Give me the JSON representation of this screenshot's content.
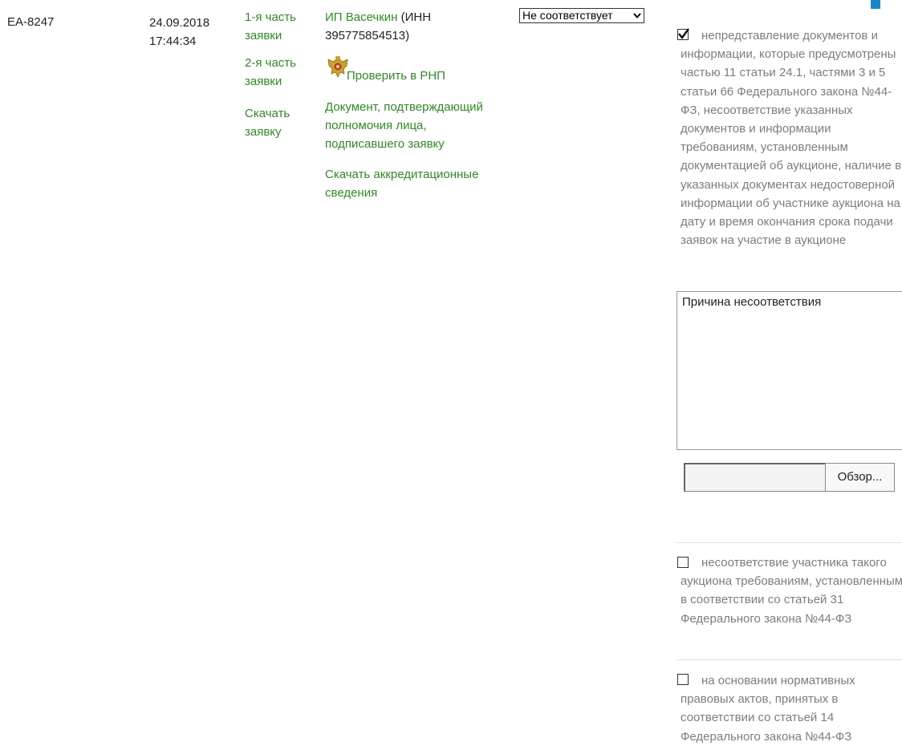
{
  "row": {
    "id": "ЕА-8247",
    "date": "24.09.2018",
    "time": "17:44:34",
    "parts": {
      "part1": [
        "1-я часть",
        "заявки"
      ],
      "part2": [
        "2-я часть",
        "заявки"
      ],
      "download": [
        "Скачать",
        "заявку"
      ]
    },
    "participant": {
      "name": "ИП Васечкин",
      "inn_line1": " (ИНН",
      "inn_line2": "395775854513)"
    },
    "rnp_check": "Проверить в РНП",
    "authority_doc": [
      "Документ, подтверждающий",
      "полномочия лица,",
      "подписавшего заявку"
    ],
    "accreditation": [
      "Скачать аккредитационные",
      "сведения"
    ],
    "decision": {
      "selected": "Не соответствует"
    }
  },
  "reasons": [
    {
      "checked": true,
      "text": "непредставление документов и информации, которые предусмотрены частью 11 статьи 24.1, частями 3 и 5 статьи 66 Федерального закона №44-ФЗ, несоответствие указанных документов и информации требованиям, установленным документацией об аукционе, наличие в указанных документах недостоверной информации об участнике аукциона на дату и время окончания срока подачи заявок на участие в аукционе"
    },
    {
      "checked": false,
      "text": "несоответствие участника такого аукциона требованиям, установленным в соответствии со статьей 31 Федерального закона №44-ФЗ"
    },
    {
      "checked": false,
      "text": "на основании нормативных правовых актов, принятых в соответствии со статьей 14 Федерального закона №44-ФЗ"
    }
  ],
  "mismatch_reason": {
    "value": "Причина несоответствия"
  },
  "file_upload": {
    "browse_label": "Обзор..."
  },
  "colors": {
    "link_green": "#2e8b22",
    "reason_gray": "#7d7d7d",
    "corner_blue": "#1b87c9"
  },
  "icons": {
    "emblem": "russian-coat-of-arms-icon",
    "checkmark": "checkmark-icon",
    "select_arrow": "chevron-down-icon"
  }
}
